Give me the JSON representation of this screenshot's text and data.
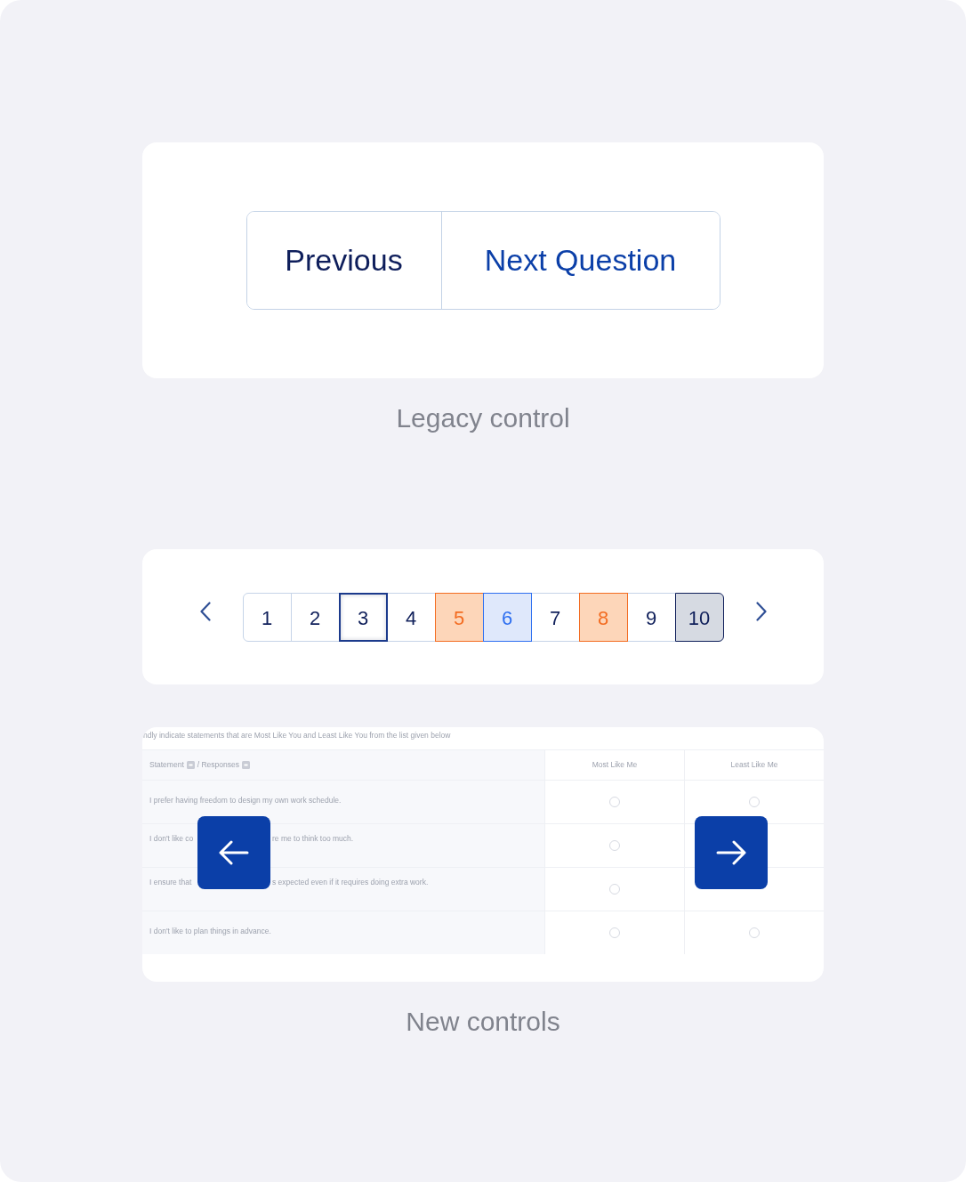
{
  "legacy_control": {
    "buttons": [
      {
        "label": "Previous",
        "kind": "secondary"
      },
      {
        "label": "Next Question",
        "kind": "primary"
      }
    ],
    "caption": "Legacy control"
  },
  "pagination": {
    "pages": [
      {
        "label": "1",
        "selected": false,
        "kind": "plain"
      },
      {
        "label": "2",
        "selected": false,
        "kind": "plain"
      },
      {
        "label": "3",
        "selected": true,
        "kind": "plain"
      },
      {
        "label": "4",
        "selected": false,
        "kind": "plain"
      },
      {
        "label": "5",
        "selected": false,
        "kind": "flagged"
      },
      {
        "label": "6",
        "selected": false,
        "kind": "answered"
      },
      {
        "label": "7",
        "selected": false,
        "kind": "plain"
      },
      {
        "label": "8",
        "selected": false,
        "kind": "flagged"
      },
      {
        "label": "9",
        "selected": false,
        "kind": "plain"
      },
      {
        "label": "10",
        "selected": false,
        "kind": "muted"
      }
    ]
  },
  "question_preview": {
    "instruction": "ndly indicate statements that are Most Like You and Least Like You from the list given below",
    "header_labels": [
      "Statement",
      "/ Responses"
    ],
    "choice_columns": [
      "Most Like Me",
      "Least Like Me"
    ],
    "rows": [
      {
        "fragments": [
          "I prefer having freedom to design my own work schedule."
        ],
        "most_like_me_checked": false,
        "least_like_me_checked": false
      },
      {
        "fragments": [
          "I don't like co",
          "re me to think too much."
        ],
        "most_like_me_checked": false
      },
      {
        "fragments": [
          "I ensure that",
          "s expected even if it requires doing extra work."
        ],
        "most_like_me_checked": false
      },
      {
        "fragments": [
          "I don't like to plan things in advance."
        ],
        "most_like_me_checked": false,
        "least_like_me_checked": false
      }
    ]
  },
  "new_controls_caption": "New controls"
}
